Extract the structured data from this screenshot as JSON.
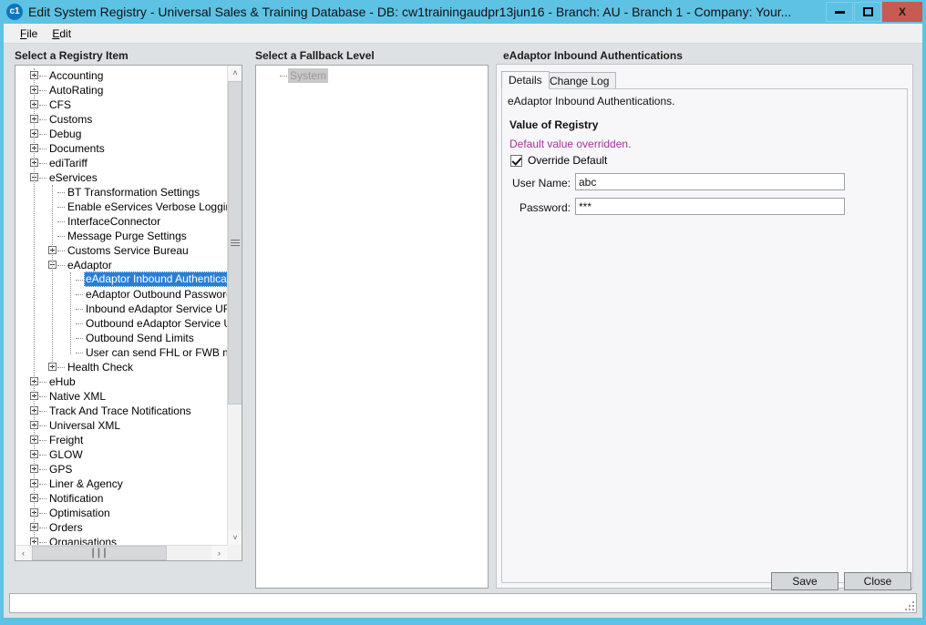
{
  "window": {
    "icon_label": "c1",
    "title": "Edit System Registry - Universal Sales & Training Database - DB: cw1trainingaudpr13jun16 - Branch: AU - Branch 1 - Company: Your...",
    "minimize_label": "minimize",
    "maximize_label": "maximize",
    "close_label": "X"
  },
  "menu": {
    "items": [
      {
        "label": "File",
        "accel": "F"
      },
      {
        "label": "Edit",
        "accel": "E"
      }
    ]
  },
  "registry_panel": {
    "header": "Select a Registry Item",
    "nodes": [
      {
        "label": "Accounting",
        "depth": 0,
        "expander": "plus"
      },
      {
        "label": "AutoRating",
        "depth": 0,
        "expander": "plus"
      },
      {
        "label": "CFS",
        "depth": 0,
        "expander": "plus"
      },
      {
        "label": "Customs",
        "depth": 0,
        "expander": "plus"
      },
      {
        "label": "Debug",
        "depth": 0,
        "expander": "plus"
      },
      {
        "label": "Documents",
        "depth": 0,
        "expander": "plus"
      },
      {
        "label": "ediTariff",
        "depth": 0,
        "expander": "plus"
      },
      {
        "label": "eServices",
        "depth": 0,
        "expander": "minus"
      },
      {
        "label": "BT Transformation Settings",
        "depth": 1,
        "expander": "none"
      },
      {
        "label": "Enable eServices Verbose Logging",
        "depth": 1,
        "expander": "none"
      },
      {
        "label": "InterfaceConnector",
        "depth": 1,
        "expander": "none"
      },
      {
        "label": "Message Purge Settings",
        "depth": 1,
        "expander": "none"
      },
      {
        "label": "Customs Service Bureau",
        "depth": 1,
        "expander": "plus"
      },
      {
        "label": "eAdaptor",
        "depth": 1,
        "expander": "minus"
      },
      {
        "label": "eAdaptor Inbound Authentications",
        "depth": 2,
        "expander": "none",
        "selected": true
      },
      {
        "label": "eAdaptor Outbound Password",
        "depth": 2,
        "expander": "none"
      },
      {
        "label": "Inbound eAdaptor Service URL",
        "depth": 2,
        "expander": "none"
      },
      {
        "label": "Outbound eAdaptor Service URL",
        "depth": 2,
        "expander": "none"
      },
      {
        "label": "Outbound Send Limits",
        "depth": 2,
        "expander": "none"
      },
      {
        "label": "User can send FHL or FWB message",
        "depth": 2,
        "expander": "none"
      },
      {
        "label": "Health Check",
        "depth": 1,
        "expander": "plus"
      },
      {
        "label": "eHub",
        "depth": 0,
        "expander": "plus"
      },
      {
        "label": "Native XML",
        "depth": 0,
        "expander": "plus"
      },
      {
        "label": "Track And Trace Notifications",
        "depth": 0,
        "expander": "plus"
      },
      {
        "label": "Universal XML",
        "depth": 0,
        "expander": "plus"
      },
      {
        "label": "Freight",
        "depth": 0,
        "expander": "plus"
      },
      {
        "label": "GLOW",
        "depth": 0,
        "expander": "plus"
      },
      {
        "label": "GPS",
        "depth": 0,
        "expander": "plus"
      },
      {
        "label": "Liner & Agency",
        "depth": 0,
        "expander": "plus"
      },
      {
        "label": "Notification",
        "depth": 0,
        "expander": "plus"
      },
      {
        "label": "Optimisation",
        "depth": 0,
        "expander": "plus"
      },
      {
        "label": "Orders",
        "depth": 0,
        "expander": "plus"
      },
      {
        "label": "Organisations",
        "depth": 0,
        "expander": "plus"
      }
    ],
    "scroll_up_glyph": "˄",
    "scroll_down_glyph": "˅",
    "scroll_left_glyph": "‹",
    "scroll_right_glyph": "›",
    "hthumb_grip": "┃┃┃"
  },
  "fallback_panel": {
    "header": "Select a Fallback Level",
    "nodes": [
      {
        "label": "System",
        "depth": 0,
        "expander": "none",
        "grayselected": true
      }
    ]
  },
  "detail_panel": {
    "group_title": "eAdaptor Inbound Authentications",
    "tabs": [
      {
        "label": "Details",
        "active": true
      },
      {
        "label": "Change Log",
        "active": false
      }
    ],
    "description": "eAdaptor Inbound Authentications.",
    "section_title": "Value of Registry",
    "override_note": "Default value overridden.",
    "override_note_color": "#a6309a",
    "override_checkbox": {
      "label": "Override Default",
      "checked": true
    },
    "fields": [
      {
        "label": "User Name:",
        "value": "abc"
      },
      {
        "label": "Password:",
        "value": "***"
      }
    ]
  },
  "footer": {
    "save_label": "Save",
    "close_label": "Close"
  },
  "statusbar": {
    "text": ""
  }
}
